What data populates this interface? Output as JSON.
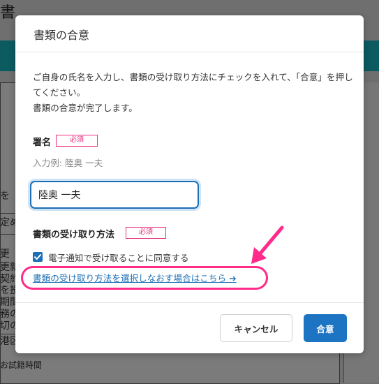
{
  "background": {
    "title_char": "書",
    "fragments": [
      "を",
      "定め",
      "更",
      "更新",
      "契約",
      "を投",
      "期間",
      "務の",
      "切の",
      "港区"
    ],
    "bottom_text": "お試籍時間"
  },
  "modal": {
    "title": "書類の合意",
    "intro": "ご自身の氏名を入力し、書類の受け取り方法にチェックを入れて、「合意」を押してください。\n書類の合意が完了します。",
    "signature": {
      "label": "署名",
      "required": "必須",
      "example": "入力例: 陸奥 一夫",
      "value": "陸奥 一夫"
    },
    "receipt": {
      "label": "書類の受け取り方法",
      "required": "必須",
      "checkbox_label": "電子通知で受け取ることに同意する",
      "checked": true,
      "link_text": "書類の受け取り方法を選択しなおす場合はこちら",
      "link_arrow": "➔"
    },
    "buttons": {
      "cancel": "キャンセル",
      "agree": "合意"
    }
  },
  "colors": {
    "accent": "#1c74c2",
    "required": "#e8337f",
    "highlight": "#ff2a8a",
    "band": "#0b5b61"
  }
}
